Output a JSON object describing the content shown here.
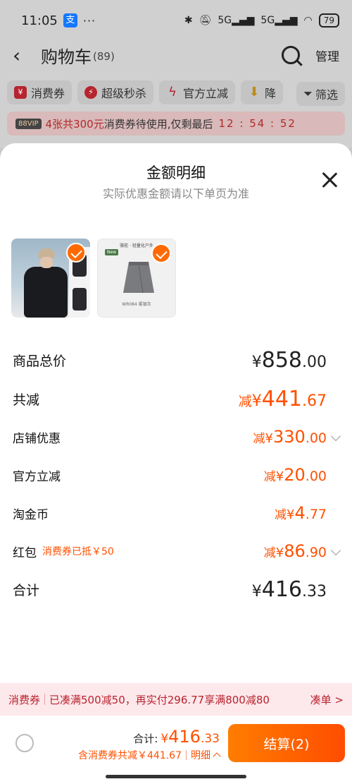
{
  "status_bar": {
    "time": "11:05",
    "alipay_icon": "支",
    "more": "···",
    "signal_5g_1": "5G",
    "signal_5g_2": "5G",
    "battery": "79"
  },
  "navbar": {
    "title": "购物车",
    "count": "(89)",
    "manage": "管理"
  },
  "chips": [
    "消费券",
    "超级秒杀",
    "官方立减",
    "降"
  ],
  "filter_label": "筛选",
  "vip_bar": {
    "badge": "88VIP",
    "highlight": "4张共300元",
    "text": "消费券待使用,仅剩最后",
    "timer": "12 : 54 : 52"
  },
  "sheet": {
    "title": "金额明细",
    "subtitle": "实际优惠金额请以下单页为准",
    "products": [
      {
        "name": "puffer-jacket"
      },
      {
        "name": "skirt",
        "brand": "骆驼 · 轻量化户外",
        "tag": "New",
        "caption": "WR084 雾银灰"
      }
    ],
    "rows": [
      {
        "label": "商品总价",
        "prefix": "",
        "symbol": "¥",
        "int": "858",
        "dec": ".00",
        "color": "#222222"
      },
      {
        "label": "共减",
        "prefix": "减",
        "symbol": "¥",
        "int": "441",
        "dec": ".67",
        "color": "#ff5000"
      },
      {
        "label": "店铺优惠",
        "prefix": "减",
        "symbol": "¥",
        "int": "330",
        "dec": ".00",
        "color": "#ff5000"
      },
      {
        "label": "官方立减",
        "prefix": "减",
        "symbol": "¥",
        "int": "20",
        "dec": ".00",
        "color": "#ff5000"
      },
      {
        "label": "淘金币",
        "prefix": "减",
        "symbol": "¥",
        "int": "4",
        "dec": ".77",
        "color": "#ff5000"
      },
      {
        "label": "红包",
        "note": "消费券已抵￥50",
        "prefix": "减",
        "symbol": "¥",
        "int": "86",
        "dec": ".90",
        "color": "#ff5000"
      },
      {
        "label": "合计",
        "prefix": "",
        "symbol": "¥",
        "int": "416",
        "dec": ".33",
        "color": "#222222"
      }
    ]
  },
  "coupon_strip": {
    "tag": "消费券",
    "text": "已凑满500减50，再实付296.77享满800减80",
    "action": "凑单 >"
  },
  "bottom_bar": {
    "total_label": "合计:",
    "total_symbol": "¥",
    "total_int": "416",
    "total_dec": ".33",
    "discount_text": "含消费券共减￥441.67",
    "detail_label": "明细",
    "pay_label": "结算(2)"
  },
  "colors": {
    "accent": "#ff5000",
    "coupon_bg": "#fde8ec",
    "coupon_text": "#b8232c"
  }
}
